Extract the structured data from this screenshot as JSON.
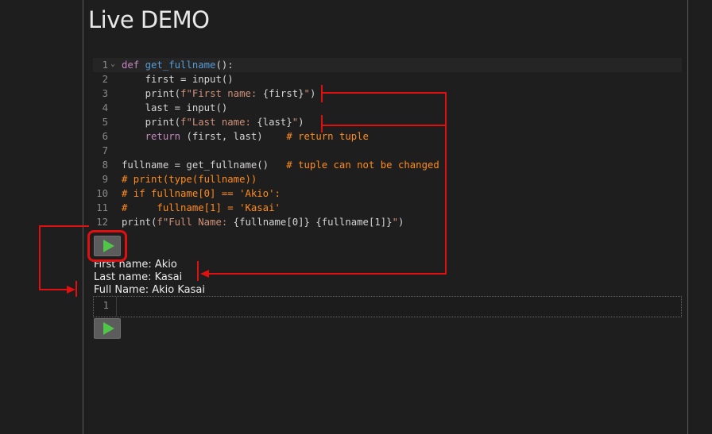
{
  "page": {
    "title": "Live DEMO"
  },
  "editor": {
    "line_numbers": [
      "1",
      "2",
      "3",
      "4",
      "5",
      "6",
      "7",
      "8",
      "9",
      "10",
      "11",
      "12"
    ],
    "lines": [
      [
        {
          "t": "kw",
          "v": "def "
        },
        {
          "t": "fn",
          "v": "get_fullname"
        },
        {
          "t": "",
          "v": "():"
        }
      ],
      [
        {
          "t": "",
          "v": "    first = input()"
        }
      ],
      [
        {
          "t": "",
          "v": "    print("
        },
        {
          "t": "str",
          "v": "f\"First name: "
        },
        {
          "t": "",
          "v": "{first}"
        },
        {
          "t": "str",
          "v": "\""
        },
        {
          "t": "",
          "v": ")"
        }
      ],
      [
        {
          "t": "",
          "v": "    last = input()"
        }
      ],
      [
        {
          "t": "",
          "v": "    print("
        },
        {
          "t": "str",
          "v": "f\"Last name: "
        },
        {
          "t": "",
          "v": "{last}"
        },
        {
          "t": "str",
          "v": "\""
        },
        {
          "t": "",
          "v": ")"
        }
      ],
      [
        {
          "t": "",
          "v": "    "
        },
        {
          "t": "kw",
          "v": "return"
        },
        {
          "t": "",
          "v": " (first, last)    "
        },
        {
          "t": "cm",
          "v": "# return tuple"
        }
      ],
      [
        {
          "t": "",
          "v": ""
        }
      ],
      [
        {
          "t": "",
          "v": "fullname = get_fullname()   "
        },
        {
          "t": "cm",
          "v": "# tuple can not be changed"
        }
      ],
      [
        {
          "t": "cm",
          "v": "# print(type(fullname))"
        }
      ],
      [
        {
          "t": "cm",
          "v": "# if fullname[0] == 'Akio':"
        }
      ],
      [
        {
          "t": "cm",
          "v": "#     fullname[1] = 'Kasai'"
        }
      ],
      [
        {
          "t": "",
          "v": "print("
        },
        {
          "t": "str",
          "v": "f\"Full Name: "
        },
        {
          "t": "",
          "v": "{fullname[0]} {fullname[1]}"
        },
        {
          "t": "str",
          "v": "\""
        },
        {
          "t": "",
          "v": ")"
        }
      ]
    ]
  },
  "output": {
    "lines": [
      "First name: Akio",
      "Last name: Kasai",
      "Full Name: Akio Kasai"
    ]
  },
  "editor2": {
    "line_numbers": [
      "1"
    ]
  },
  "icons": {
    "run": "play-icon",
    "fold": "chevron-down-icon"
  },
  "colors": {
    "annotation": "#e01010",
    "play": "#4fc648"
  }
}
